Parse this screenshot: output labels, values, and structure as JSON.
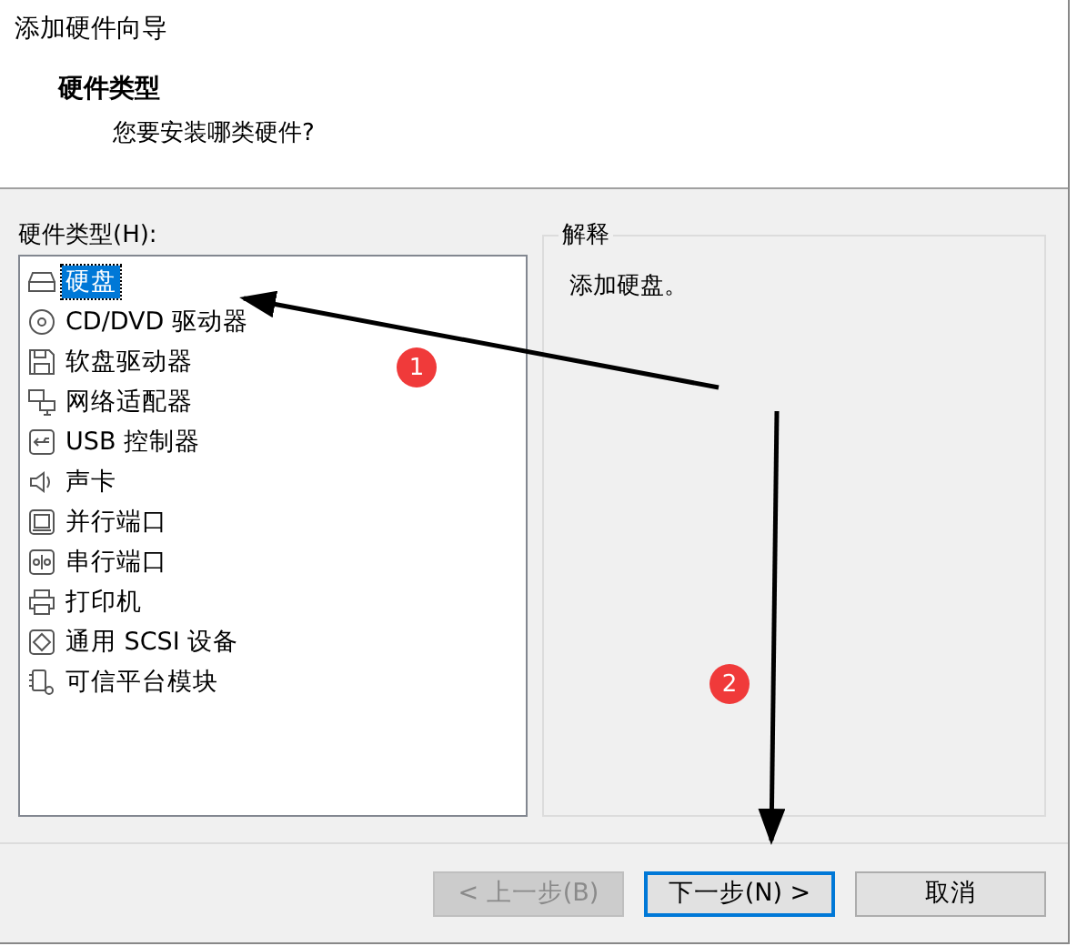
{
  "window": {
    "title": "添加硬件向导"
  },
  "header": {
    "title": "硬件类型",
    "subtitle": "您要安装哪类硬件?"
  },
  "hardware_list": {
    "label": "硬件类型(H):",
    "items": [
      {
        "kind": "disk",
        "label": "硬盘",
        "selected": true
      },
      {
        "kind": "cd",
        "label": "CD/DVD 驱动器",
        "selected": false
      },
      {
        "kind": "floppy",
        "label": "软盘驱动器",
        "selected": false
      },
      {
        "kind": "network",
        "label": "网络适配器",
        "selected": false
      },
      {
        "kind": "usb",
        "label": "USB 控制器",
        "selected": false
      },
      {
        "kind": "sound",
        "label": "声卡",
        "selected": false
      },
      {
        "kind": "parallel",
        "label": "并行端口",
        "selected": false
      },
      {
        "kind": "serial",
        "label": "串行端口",
        "selected": false
      },
      {
        "kind": "printer",
        "label": "打印机",
        "selected": false
      },
      {
        "kind": "scsi",
        "label": "通用 SCSI 设备",
        "selected": false
      },
      {
        "kind": "tpm",
        "label": "可信平台模块",
        "selected": false
      }
    ]
  },
  "explanation": {
    "title": "解释",
    "text": "添加硬盘。"
  },
  "buttons": [
    {
      "label": "< 上一步(B)",
      "disabled": true,
      "focused": false
    },
    {
      "label": "下一步(N) >",
      "disabled": false,
      "focused": true
    },
    {
      "label": "取消",
      "disabled": false,
      "focused": false
    }
  ],
  "annotations": [
    {
      "label": "1"
    },
    {
      "label": "2"
    }
  ]
}
